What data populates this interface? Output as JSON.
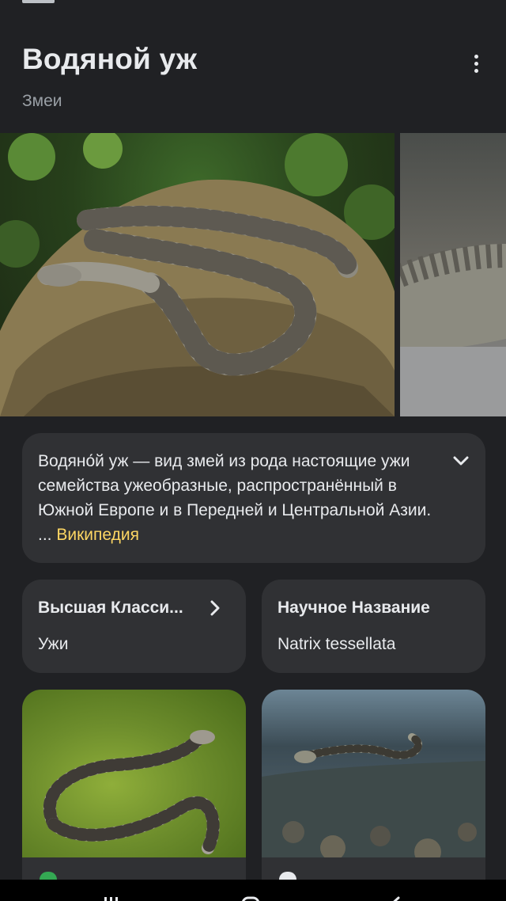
{
  "header": {
    "title": "Водяной уж",
    "subtitle": "Змеи"
  },
  "description": {
    "text": "Водяно́й уж — вид змей из рода настоящие ужи семейства ужеобразные, распространённый в Южной Европе и в Передней и Центральной Азии. ... ",
    "source_link": "Википедия"
  },
  "facts": [
    {
      "label": "Высшая Класси...",
      "value": "Ужи"
    },
    {
      "label": "Научное Название",
      "value": "Natrix tessellata"
    }
  ],
  "colors": {
    "background": "#202124",
    "card": "#303134",
    "link": "#fdd663",
    "secondary_text": "#9aa0a6"
  },
  "icons": {
    "more": "more-vert-icon",
    "expand": "chevron-down-icon",
    "fact_arrow": "chevron-right-icon",
    "nav": [
      "recent-apps-icon",
      "home-icon",
      "back-icon"
    ]
  }
}
